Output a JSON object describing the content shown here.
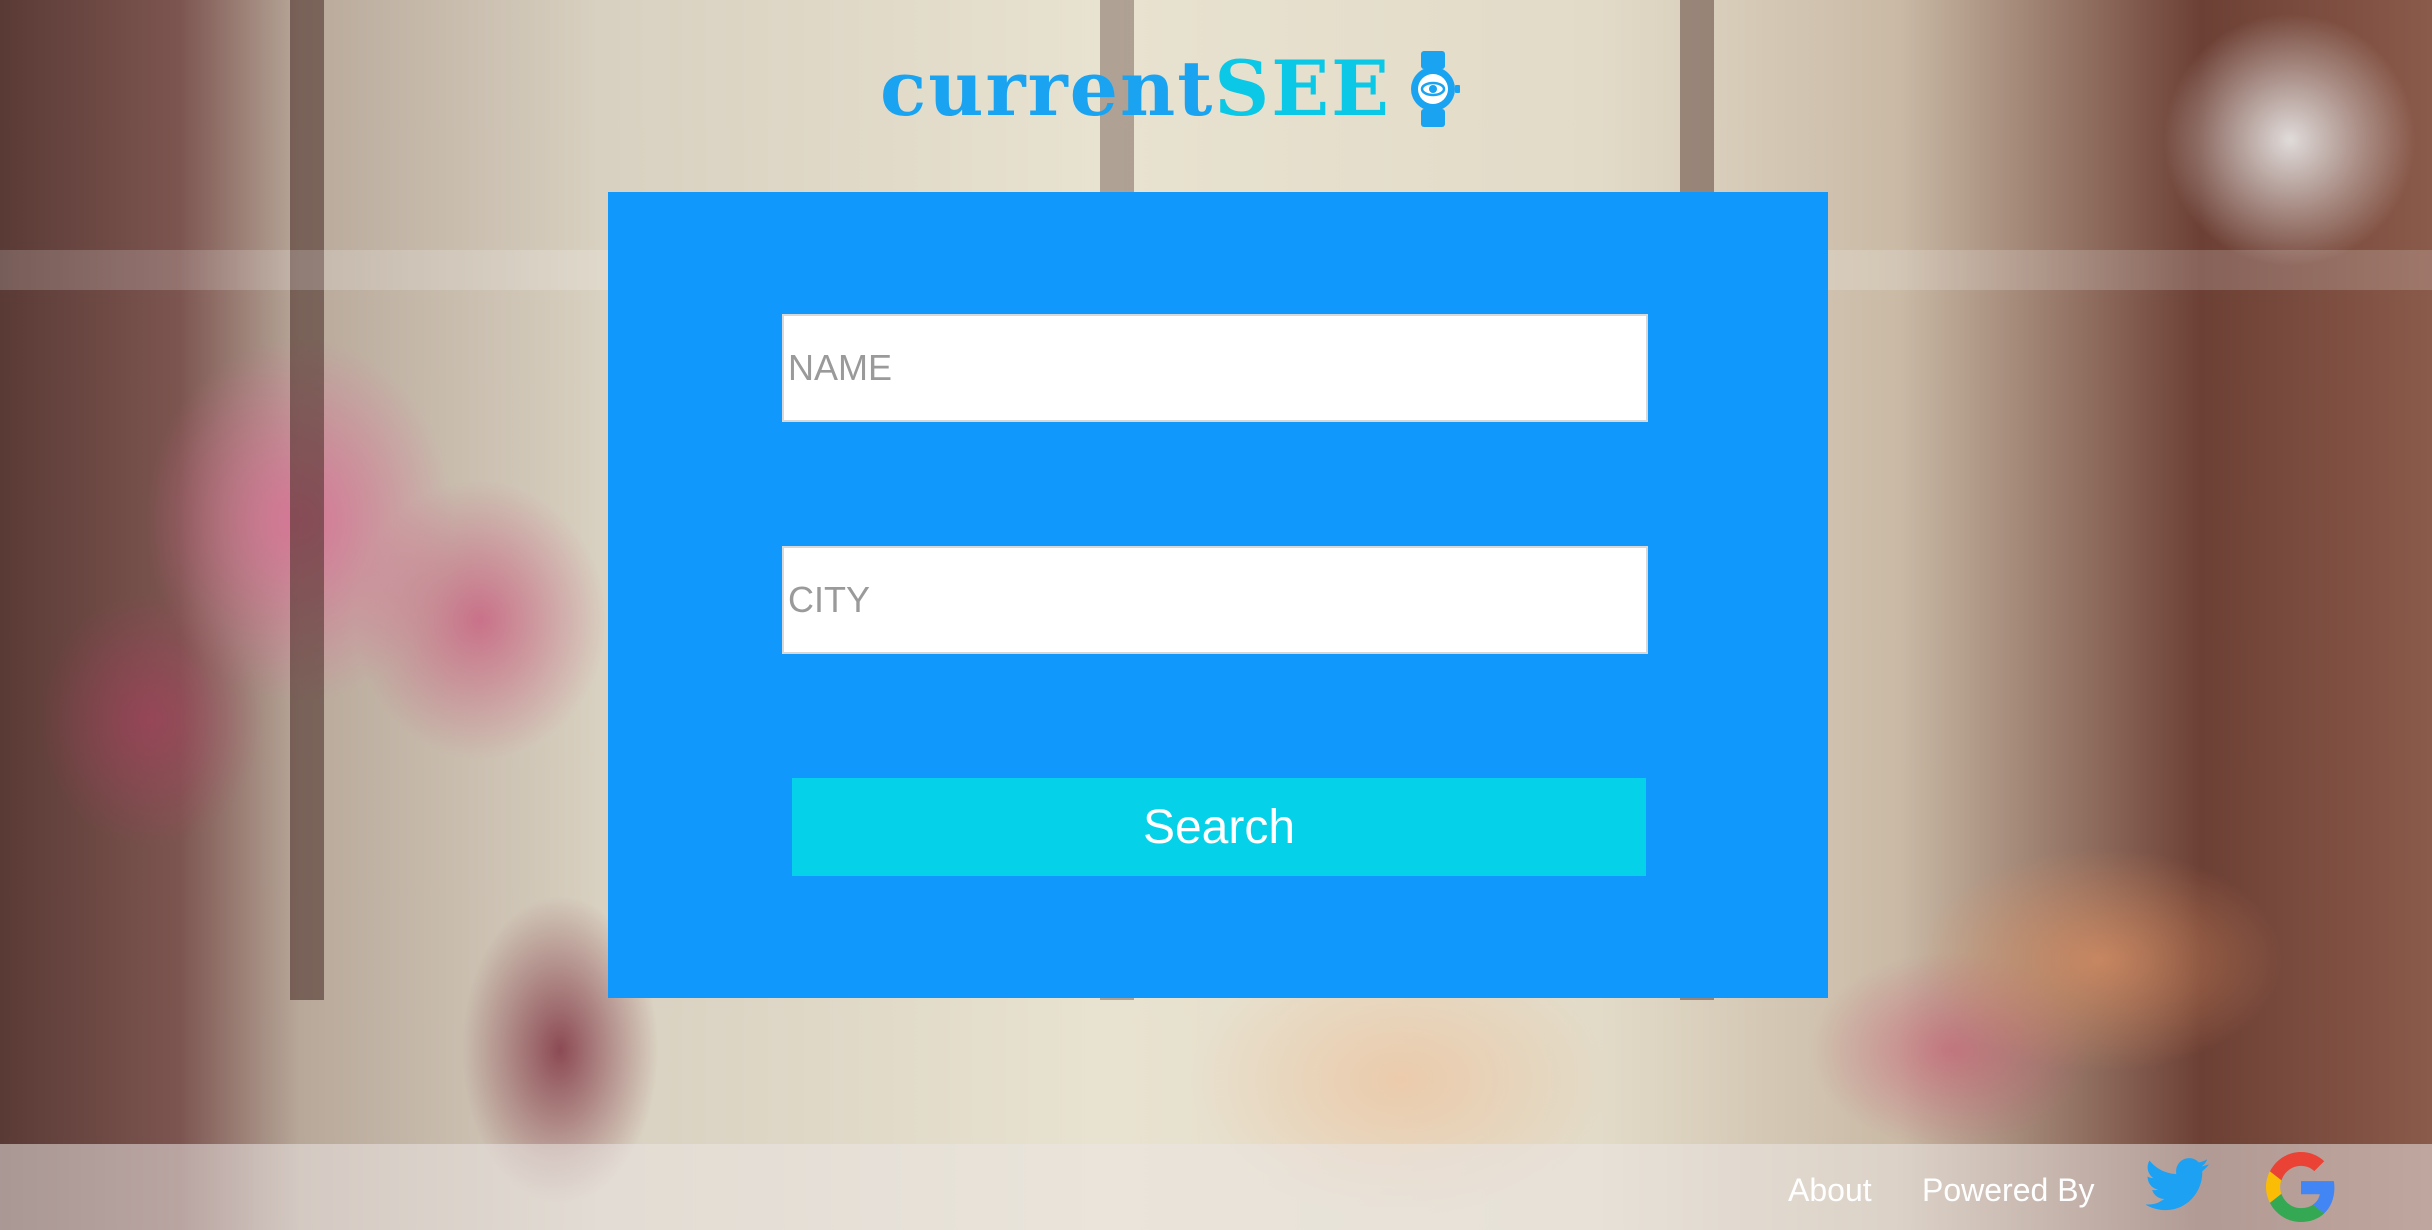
{
  "brand": {
    "logo_part1": "current",
    "logo_part2": "SEE",
    "logo_icon": "watch-eye-icon",
    "color_primary": "#1aa3f0",
    "color_accent": "#0ac8e6"
  },
  "form": {
    "name_placeholder": "NAME",
    "city_placeholder": "CITY",
    "search_label": "Search",
    "card_color": "#1098fc",
    "button_color": "#05d2e8"
  },
  "footer": {
    "about_label": "About",
    "powered_label": "Powered By",
    "twitter_icon": "twitter-icon",
    "google_icon": "google-icon"
  }
}
